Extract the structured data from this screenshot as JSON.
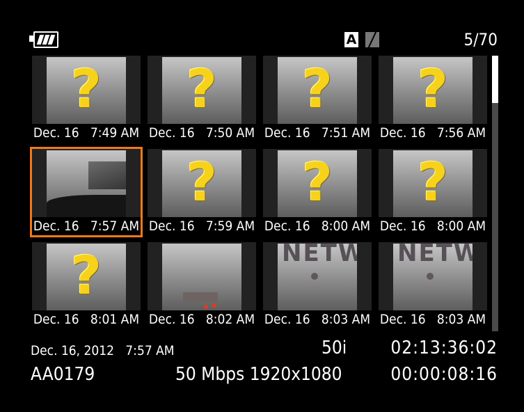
{
  "status": {
    "counter": "5/70",
    "mode_a_label": "A",
    "battery_icon": "battery-icon",
    "accent_color": "#f07a16"
  },
  "thumbnails": [
    {
      "stamp": "Dec. 16   7:49 AM",
      "kind": "unknown"
    },
    {
      "stamp": "Dec. 16   7:50 AM",
      "kind": "unknown"
    },
    {
      "stamp": "Dec. 16   7:51 AM",
      "kind": "unknown"
    },
    {
      "stamp": "Dec. 16   7:56 AM",
      "kind": "unknown"
    },
    {
      "stamp": "Dec. 16   7:57 AM",
      "kind": "road",
      "selected": true
    },
    {
      "stamp": "Dec. 16   7:59 AM",
      "kind": "unknown"
    },
    {
      "stamp": "Dec. 16   8:00 AM",
      "kind": "unknown"
    },
    {
      "stamp": "Dec. 16   8:00 AM",
      "kind": "unknown"
    },
    {
      "stamp": "Dec. 16   8:01 AM",
      "kind": "unknown"
    },
    {
      "stamp": "Dec. 16   8:02 AM",
      "kind": "trees"
    },
    {
      "stamp": "Dec. 16   8:03 AM",
      "kind": "sign"
    },
    {
      "stamp": "Dec. 16   8:03 AM",
      "kind": "sign"
    }
  ],
  "unknown_glyph": "?",
  "info": {
    "date_time": "Dec. 16, 2012   7:57 AM",
    "clip_name": "AA0179",
    "frame_rate": "50i",
    "bitrate_resolution": "50 Mbps 1920x1080",
    "timecode": "02:13:36:02",
    "duration": "00:00:08:16"
  }
}
